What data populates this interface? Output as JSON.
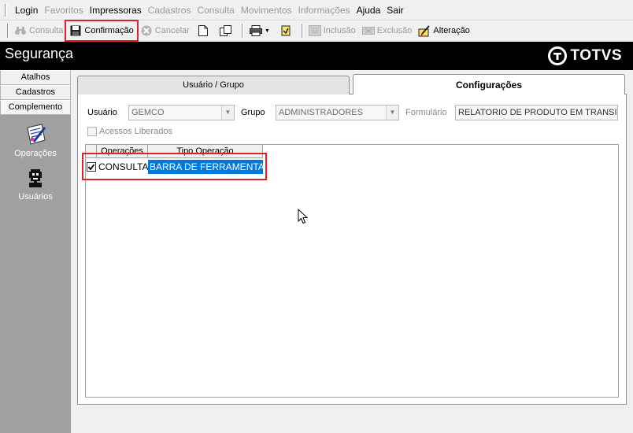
{
  "menu": {
    "items": [
      {
        "label": "Login",
        "disabled": false
      },
      {
        "label": "Favoritos",
        "disabled": true
      },
      {
        "label": "Impressoras",
        "disabled": false
      },
      {
        "label": "Cadastros",
        "disabled": true
      },
      {
        "label": "Consulta",
        "disabled": true
      },
      {
        "label": "Movimentos",
        "disabled": true
      },
      {
        "label": "Informações",
        "disabled": true
      },
      {
        "label": "Ajuda",
        "disabled": false
      },
      {
        "label": "Sair",
        "disabled": false
      }
    ]
  },
  "toolbar": {
    "consulta": "Consulta",
    "confirmacao": "Confirmação",
    "cancelar": "Cancelar",
    "inclusao": "Inclusão",
    "exclusao": "Exclusão",
    "alteracao": "Alteração"
  },
  "banner": {
    "title": "Segurança",
    "logo_text": "TOTVS"
  },
  "leftnav": {
    "sections": [
      "Atalhos",
      "Cadastros",
      "Complemento"
    ],
    "items": [
      {
        "label": "Operações",
        "icon": "operations-icon"
      },
      {
        "label": "Usuários",
        "icon": "users-icon"
      }
    ]
  },
  "tabs": {
    "usuario_grupo": "Usuário  / Grupo",
    "configuracoes": "Configurações"
  },
  "form": {
    "usuario_label": "Usuário",
    "usuario_value": "GEMCO",
    "grupo_label": "Grupo",
    "grupo_value": "ADMINISTRADORES",
    "formulario_label": "Formulário",
    "formulario_value": "RELATORIO DE PRODUTO EM TRANSITO",
    "acessos_label": "Acessos Liberados"
  },
  "grid": {
    "columns": [
      "Operações",
      "Tipo Operação"
    ],
    "rows": [
      {
        "checked": true,
        "operacao": "CONSULTA",
        "tipo": "BARRA DE FERRAMENTAS"
      }
    ]
  },
  "colors": {
    "highlight": "#e0202a",
    "selection": "#0078d7",
    "banner_bg": "#000000",
    "nav_bg": "#a0a0a0"
  }
}
